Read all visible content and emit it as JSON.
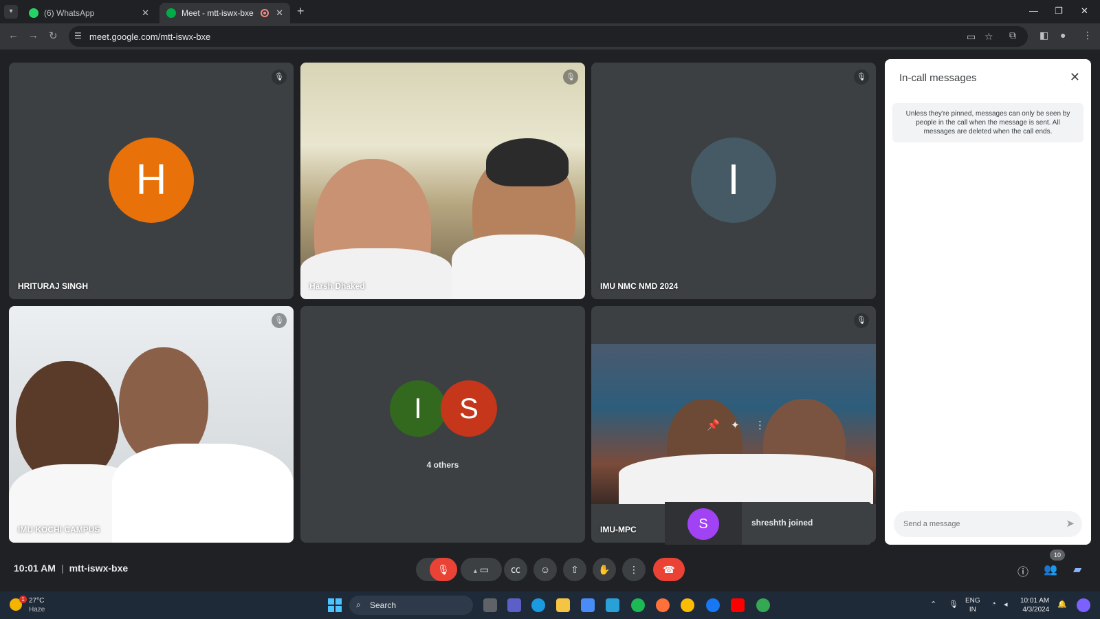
{
  "browser": {
    "tabs": [
      {
        "title": "(6) WhatsApp",
        "favicon": "whatsapp-icon",
        "color": "#25d366"
      },
      {
        "title": "Meet - mtt-iswx-bxe",
        "favicon": "google-meet-icon",
        "color": "#00ac47"
      }
    ],
    "url": "meet.google.com/mtt-iswx-bxe"
  },
  "tiles": [
    {
      "name": "HRITURAJ SINGH",
      "initial": "H",
      "color": "#e8710a"
    },
    {
      "name": "Harsh Dhaked"
    },
    {
      "name": "IMU NMC NMD 2024",
      "initial": "I",
      "color": "#455a64"
    },
    {
      "name": "IMU KOCHI CAMPUS"
    },
    {
      "others_label": "4 others",
      "initials": [
        {
          "initial": "I",
          "color": "#33691e"
        },
        {
          "initial": "S",
          "color": "#c5361b"
        }
      ]
    },
    {
      "name": "IMU-MPC"
    }
  ],
  "toast": {
    "initial": "S",
    "text": "shreshth joined",
    "color": "#a142f4"
  },
  "panel": {
    "title": "In-call messages",
    "note": "Unless they're pinned, messages can only be seen by people in the call when the message is sent. All messages are deleted when the call ends.",
    "input_placeholder": "Send a message"
  },
  "meeting": {
    "time": "10:01 AM",
    "code": "mtt-iswx-bxe",
    "participants_count": "10"
  },
  "taskbar": {
    "temperature": "27°C",
    "condition": "Haze",
    "weather_badge": "1",
    "search": "Search",
    "lang_line1": "ENG",
    "lang_line2": "IN",
    "time": "10:01 AM",
    "date": "4/3/2024"
  }
}
